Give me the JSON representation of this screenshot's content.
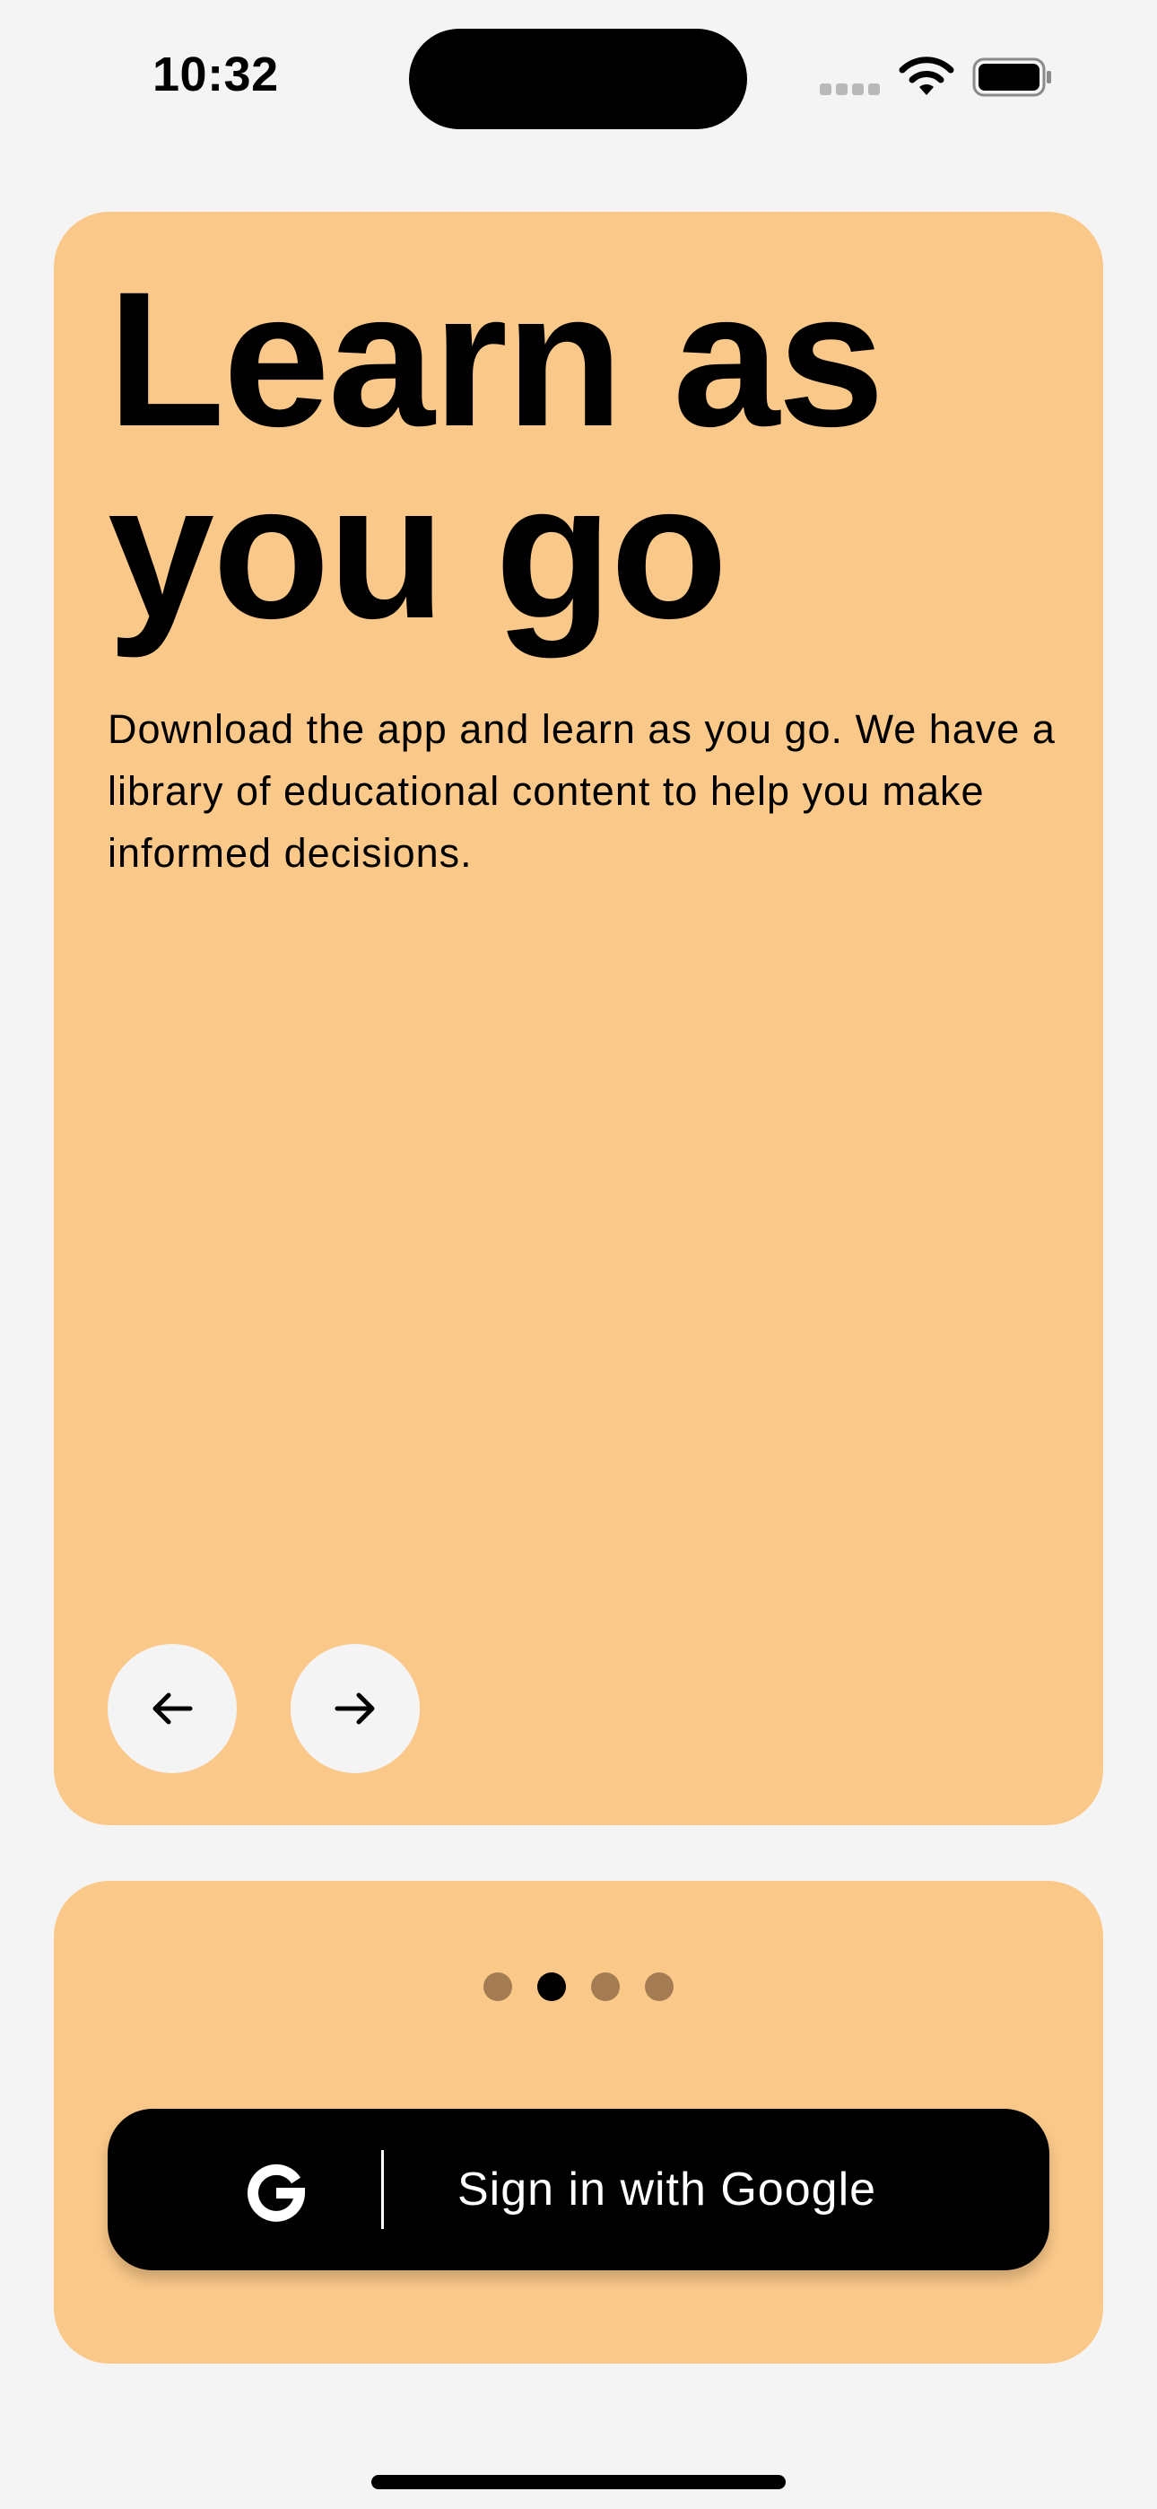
{
  "status_bar": {
    "time": "10:32",
    "icons": [
      "cell-signal-icon",
      "wifi-icon",
      "battery-icon"
    ]
  },
  "onboarding": {
    "headline": "Learn as\nyou go",
    "description": "Download the app and learn as you go. We have a library of educational content to help you make informed decisions.",
    "prev_icon": "arrow-left-icon",
    "next_icon": "arrow-right-icon",
    "page_count": 4,
    "active_page": 2
  },
  "signin": {
    "google_label": "Sign in with Google",
    "icon": "google-icon"
  },
  "colors": {
    "background": "#f4f4f4",
    "card": "#fac889",
    "dot_inactive": "#a47c53",
    "dot_active": "#000000",
    "button": "#000000"
  }
}
